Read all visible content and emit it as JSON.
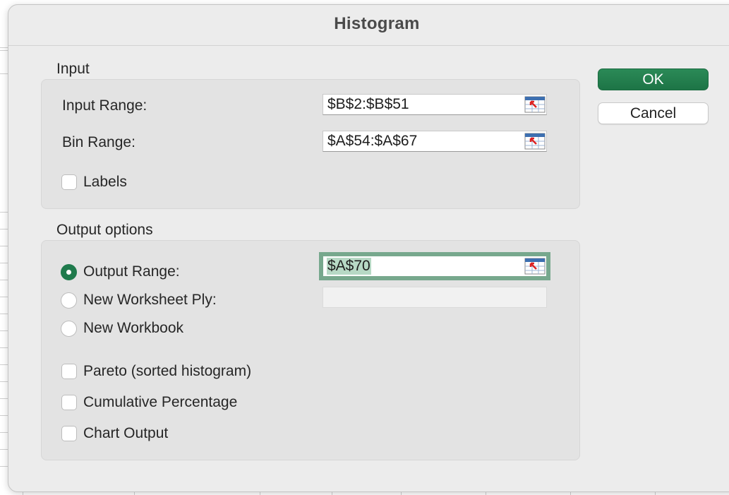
{
  "dialog": {
    "title": "Histogram"
  },
  "input": {
    "group_label": "Input",
    "input_range": {
      "label": "Input Range:",
      "value": "$B$2:$B$51"
    },
    "bin_range": {
      "label": "Bin Range:",
      "value": "$A$54:$A$67"
    },
    "labels_checkbox": {
      "label": "Labels",
      "checked": false
    }
  },
  "output": {
    "group_label": "Output options",
    "output_range": {
      "label": "Output Range:",
      "value": "$A$70",
      "selected": true
    },
    "new_worksheet_ply": {
      "label": "New Worksheet Ply:",
      "value": "",
      "selected": false
    },
    "new_workbook": {
      "label": "New Workbook",
      "selected": false
    },
    "pareto": {
      "label": "Pareto (sorted histogram)",
      "checked": false
    },
    "cumulative_percentage": {
      "label": "Cumulative Percentage",
      "checked": false
    },
    "chart_output": {
      "label": "Chart Output",
      "checked": false
    }
  },
  "buttons": {
    "ok": "OK",
    "cancel": "Cancel"
  },
  "icons": {
    "range_selector": "collapse-dialog-icon"
  },
  "colors": {
    "accent": "#1f7a4c",
    "focus_ring": "#77a88d"
  }
}
